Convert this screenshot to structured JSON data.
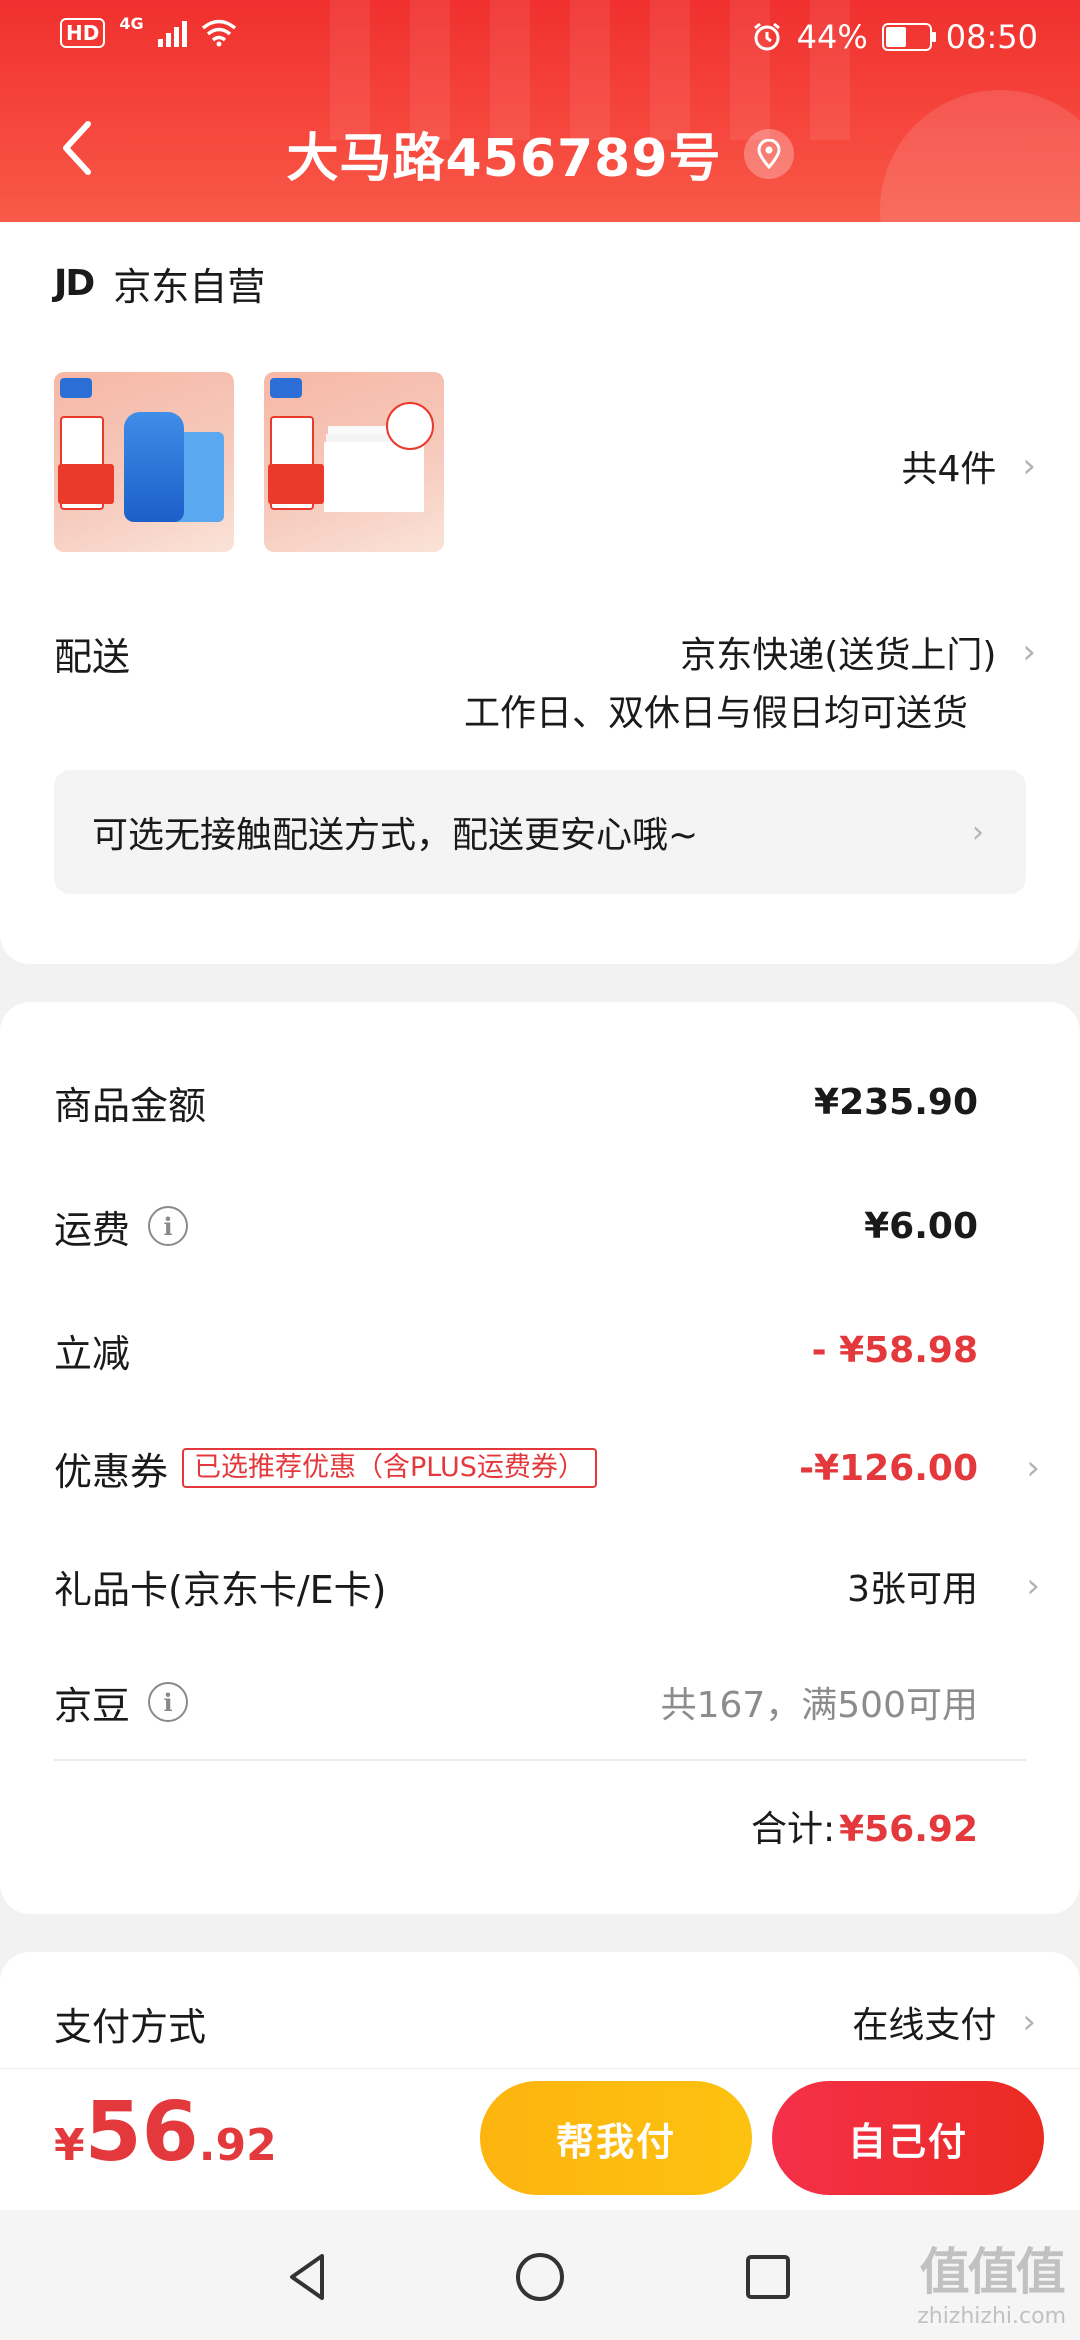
{
  "status_bar": {
    "hd": "HD",
    "network": "4G",
    "battery_percent": "44%",
    "battery_level": 0.44,
    "time": "08:50"
  },
  "header": {
    "title": "大马路456789号"
  },
  "order": {
    "store_logo": "JD",
    "store_name": "京东自营",
    "item_count": "共4件",
    "delivery_label": "配送",
    "delivery_method": "京东快递(送货上门)",
    "delivery_time": "工作日、双休日与假日均可送货",
    "contactless_notice": "可选无接触配送方式，配送更安心哦~"
  },
  "summary": {
    "goods_label": "商品金额",
    "goods_value": "¥235.90",
    "freight_label": "运费",
    "freight_value": "¥6.00",
    "discount_label": "立减",
    "discount_value": "- ¥58.98",
    "coupon_label": "优惠券",
    "coupon_tag": "已选推荐优惠（含PLUS运费券）",
    "coupon_value": "-¥126.00",
    "giftcard_label": "礼品卡(京东卡/E卡)",
    "giftcard_value": "3张可用",
    "jingdou_label": "京豆",
    "jingdou_value": "共167，满500可用",
    "total_label": "合计:",
    "total_value": "¥56.92"
  },
  "payment": {
    "label": "支付方式",
    "value": "在线支付"
  },
  "bottom": {
    "currency": "¥",
    "price_int": "56",
    "price_dec": ".92",
    "help_pay": "帮我付",
    "self_pay": "自己付"
  },
  "watermark": {
    "logo": "值值值",
    "site": "zhizhizhi.com"
  },
  "colors": {
    "brand_red": "#e4393c",
    "header_red": "#f0302e",
    "help_yellow": "#fdb40f"
  }
}
